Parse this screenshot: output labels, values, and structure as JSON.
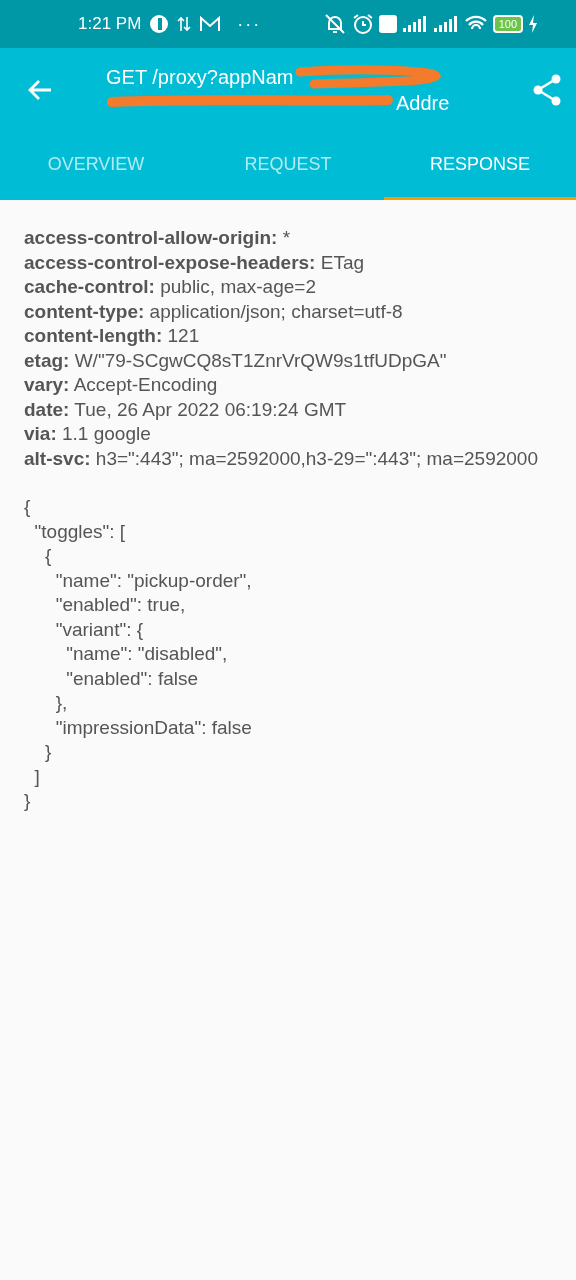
{
  "status_bar": {
    "time": "1:21 PM",
    "overflow": "···",
    "battery": "100"
  },
  "toolbar": {
    "title_line_1": "GET /proxy?appNam",
    "title_line_2": "Addre"
  },
  "tabs": [
    {
      "label": "OVERVIEW",
      "selected": false
    },
    {
      "label": "REQUEST",
      "selected": false
    },
    {
      "label": "RESPONSE",
      "selected": true
    }
  ],
  "headers": [
    {
      "name": "access-control-allow-origin:",
      "value": "*"
    },
    {
      "name": "access-control-expose-headers:",
      "value": "ETag"
    },
    {
      "name": "cache-control:",
      "value": "public, max-age=2"
    },
    {
      "name": "content-type:",
      "value": "application/json; charset=utf-8"
    },
    {
      "name": "content-length:",
      "value": "121"
    },
    {
      "name": "etag:",
      "value": "W/\"79-SCgwCQ8sT1ZnrVrQW9s1tfUDpGA\""
    },
    {
      "name": "vary:",
      "value": "Accept-Encoding"
    },
    {
      "name": "date:",
      "value": "Tue, 26 Apr 2022 06:19:24 GMT"
    },
    {
      "name": "via:",
      "value": "1.1 google"
    },
    {
      "name": "alt-svc:",
      "value": "h3=\":443\"; ma=2592000,h3-29=\":443\"; ma=2592000"
    }
  ],
  "body_lines": [
    "{",
    "  \"toggles\": [",
    "    {",
    "      \"name\": \"pickup-order\",",
    "      \"enabled\": true,",
    "      \"variant\": {",
    "        \"name\": \"disabled\",",
    "        \"enabled\": false",
    "      },",
    "      \"impressionData\": false",
    "    }",
    "  ]",
    "}"
  ]
}
